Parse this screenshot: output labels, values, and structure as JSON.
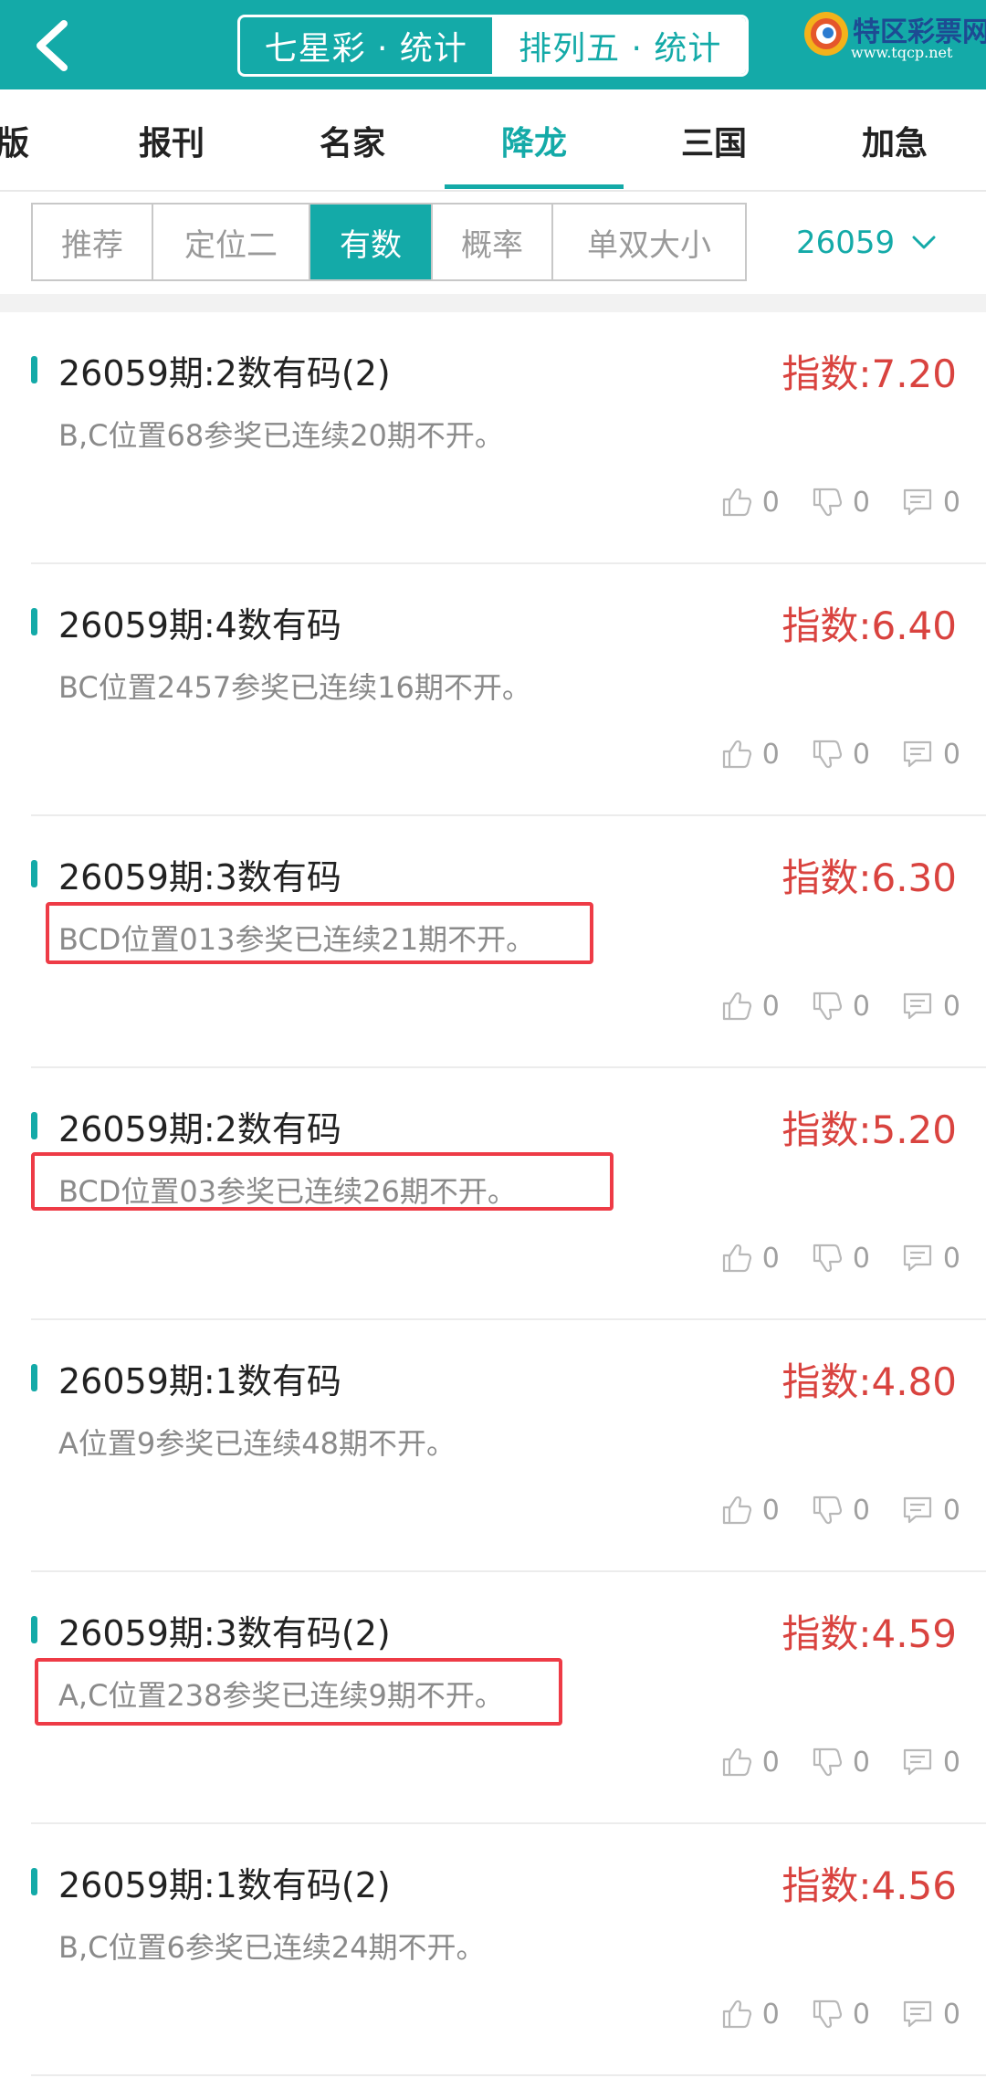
{
  "header": {
    "seg_tabs": [
      {
        "label": "七星彩 · 统计",
        "active": false
      },
      {
        "label": "排列五 · 统计",
        "active": true
      }
    ],
    "logo_text": "特区彩票网",
    "logo_url": "www.tqcp.net"
  },
  "category_tabs": [
    {
      "label": "版",
      "active": false
    },
    {
      "label": "报刊",
      "active": false
    },
    {
      "label": "名家",
      "active": false
    },
    {
      "label": "降龙",
      "active": true
    },
    {
      "label": "三国",
      "active": false
    },
    {
      "label": "加急",
      "active": false
    }
  ],
  "sub_tabs": [
    {
      "label": "推荐",
      "active": false
    },
    {
      "label": "定位二",
      "active": false
    },
    {
      "label": "有数",
      "active": true
    },
    {
      "label": "概率",
      "active": false
    },
    {
      "label": "单双大小",
      "active": false
    }
  ],
  "issue": "26059",
  "colors": {
    "accent": "#14aaa8",
    "index_red": "#d9433f",
    "highlight_red": "#ee3b46"
  },
  "items": [
    {
      "title": "26059期:2数有码(2)",
      "index": "指数:7.20",
      "desc": "B,C位置68参奖已连续20期不开。",
      "likes": "0",
      "dislikes": "0",
      "comments": "0",
      "highlighted": false
    },
    {
      "title": "26059期:4数有码",
      "index": "指数:6.40",
      "desc": "BC位置2457参奖已连续16期不开。",
      "likes": "0",
      "dislikes": "0",
      "comments": "0",
      "highlighted": false
    },
    {
      "title": "26059期:3数有码",
      "index": "指数:6.30",
      "desc": "BCD位置013参奖已连续21期不开。",
      "likes": "0",
      "dislikes": "0",
      "comments": "0",
      "highlighted": true
    },
    {
      "title": "26059期:2数有码",
      "index": "指数:5.20",
      "desc": "BCD位置03参奖已连续26期不开。",
      "likes": "0",
      "dislikes": "0",
      "comments": "0",
      "highlighted": true
    },
    {
      "title": "26059期:1数有码",
      "index": "指数:4.80",
      "desc": "A位置9参奖已连续48期不开。",
      "likes": "0",
      "dislikes": "0",
      "comments": "0",
      "highlighted": false
    },
    {
      "title": "26059期:3数有码(2)",
      "index": "指数:4.59",
      "desc": "A,C位置238参奖已连续9期不开。",
      "likes": "0",
      "dislikes": "0",
      "comments": "0",
      "highlighted": true
    },
    {
      "title": "26059期:1数有码(2)",
      "index": "指数:4.56",
      "desc": "B,C位置6参奖已连续24期不开。",
      "likes": "0",
      "dislikes": "0",
      "comments": "0",
      "highlighted": false
    }
  ]
}
